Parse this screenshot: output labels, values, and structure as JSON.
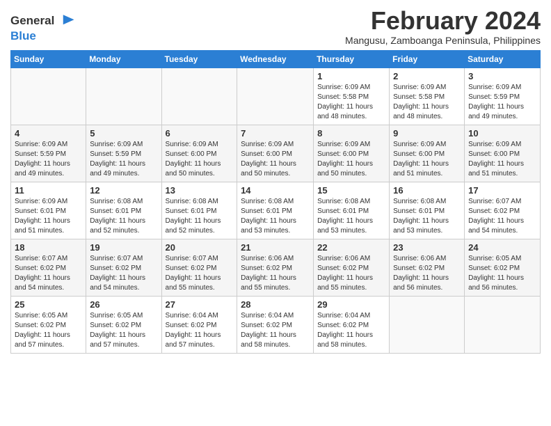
{
  "logo": {
    "line1": "General",
    "line2": "Blue"
  },
  "title": "February 2024",
  "subtitle": "Mangusu, Zamboanga Peninsula, Philippines",
  "days_of_week": [
    "Sunday",
    "Monday",
    "Tuesday",
    "Wednesday",
    "Thursday",
    "Friday",
    "Saturday"
  ],
  "weeks": [
    [
      {
        "day": "",
        "info": ""
      },
      {
        "day": "",
        "info": ""
      },
      {
        "day": "",
        "info": ""
      },
      {
        "day": "",
        "info": ""
      },
      {
        "day": "1",
        "info": "Sunrise: 6:09 AM\nSunset: 5:58 PM\nDaylight: 11 hours\nand 48 minutes."
      },
      {
        "day": "2",
        "info": "Sunrise: 6:09 AM\nSunset: 5:58 PM\nDaylight: 11 hours\nand 48 minutes."
      },
      {
        "day": "3",
        "info": "Sunrise: 6:09 AM\nSunset: 5:59 PM\nDaylight: 11 hours\nand 49 minutes."
      }
    ],
    [
      {
        "day": "4",
        "info": "Sunrise: 6:09 AM\nSunset: 5:59 PM\nDaylight: 11 hours\nand 49 minutes."
      },
      {
        "day": "5",
        "info": "Sunrise: 6:09 AM\nSunset: 5:59 PM\nDaylight: 11 hours\nand 49 minutes."
      },
      {
        "day": "6",
        "info": "Sunrise: 6:09 AM\nSunset: 6:00 PM\nDaylight: 11 hours\nand 50 minutes."
      },
      {
        "day": "7",
        "info": "Sunrise: 6:09 AM\nSunset: 6:00 PM\nDaylight: 11 hours\nand 50 minutes."
      },
      {
        "day": "8",
        "info": "Sunrise: 6:09 AM\nSunset: 6:00 PM\nDaylight: 11 hours\nand 50 minutes."
      },
      {
        "day": "9",
        "info": "Sunrise: 6:09 AM\nSunset: 6:00 PM\nDaylight: 11 hours\nand 51 minutes."
      },
      {
        "day": "10",
        "info": "Sunrise: 6:09 AM\nSunset: 6:00 PM\nDaylight: 11 hours\nand 51 minutes."
      }
    ],
    [
      {
        "day": "11",
        "info": "Sunrise: 6:09 AM\nSunset: 6:01 PM\nDaylight: 11 hours\nand 51 minutes."
      },
      {
        "day": "12",
        "info": "Sunrise: 6:08 AM\nSunset: 6:01 PM\nDaylight: 11 hours\nand 52 minutes."
      },
      {
        "day": "13",
        "info": "Sunrise: 6:08 AM\nSunset: 6:01 PM\nDaylight: 11 hours\nand 52 minutes."
      },
      {
        "day": "14",
        "info": "Sunrise: 6:08 AM\nSunset: 6:01 PM\nDaylight: 11 hours\nand 53 minutes."
      },
      {
        "day": "15",
        "info": "Sunrise: 6:08 AM\nSunset: 6:01 PM\nDaylight: 11 hours\nand 53 minutes."
      },
      {
        "day": "16",
        "info": "Sunrise: 6:08 AM\nSunset: 6:01 PM\nDaylight: 11 hours\nand 53 minutes."
      },
      {
        "day": "17",
        "info": "Sunrise: 6:07 AM\nSunset: 6:02 PM\nDaylight: 11 hours\nand 54 minutes."
      }
    ],
    [
      {
        "day": "18",
        "info": "Sunrise: 6:07 AM\nSunset: 6:02 PM\nDaylight: 11 hours\nand 54 minutes."
      },
      {
        "day": "19",
        "info": "Sunrise: 6:07 AM\nSunset: 6:02 PM\nDaylight: 11 hours\nand 54 minutes."
      },
      {
        "day": "20",
        "info": "Sunrise: 6:07 AM\nSunset: 6:02 PM\nDaylight: 11 hours\nand 55 minutes."
      },
      {
        "day": "21",
        "info": "Sunrise: 6:06 AM\nSunset: 6:02 PM\nDaylight: 11 hours\nand 55 minutes."
      },
      {
        "day": "22",
        "info": "Sunrise: 6:06 AM\nSunset: 6:02 PM\nDaylight: 11 hours\nand 55 minutes."
      },
      {
        "day": "23",
        "info": "Sunrise: 6:06 AM\nSunset: 6:02 PM\nDaylight: 11 hours\nand 56 minutes."
      },
      {
        "day": "24",
        "info": "Sunrise: 6:05 AM\nSunset: 6:02 PM\nDaylight: 11 hours\nand 56 minutes."
      }
    ],
    [
      {
        "day": "25",
        "info": "Sunrise: 6:05 AM\nSunset: 6:02 PM\nDaylight: 11 hours\nand 57 minutes."
      },
      {
        "day": "26",
        "info": "Sunrise: 6:05 AM\nSunset: 6:02 PM\nDaylight: 11 hours\nand 57 minutes."
      },
      {
        "day": "27",
        "info": "Sunrise: 6:04 AM\nSunset: 6:02 PM\nDaylight: 11 hours\nand 57 minutes."
      },
      {
        "day": "28",
        "info": "Sunrise: 6:04 AM\nSunset: 6:02 PM\nDaylight: 11 hours\nand 58 minutes."
      },
      {
        "day": "29",
        "info": "Sunrise: 6:04 AM\nSunset: 6:02 PM\nDaylight: 11 hours\nand 58 minutes."
      },
      {
        "day": "",
        "info": ""
      },
      {
        "day": "",
        "info": ""
      }
    ]
  ]
}
